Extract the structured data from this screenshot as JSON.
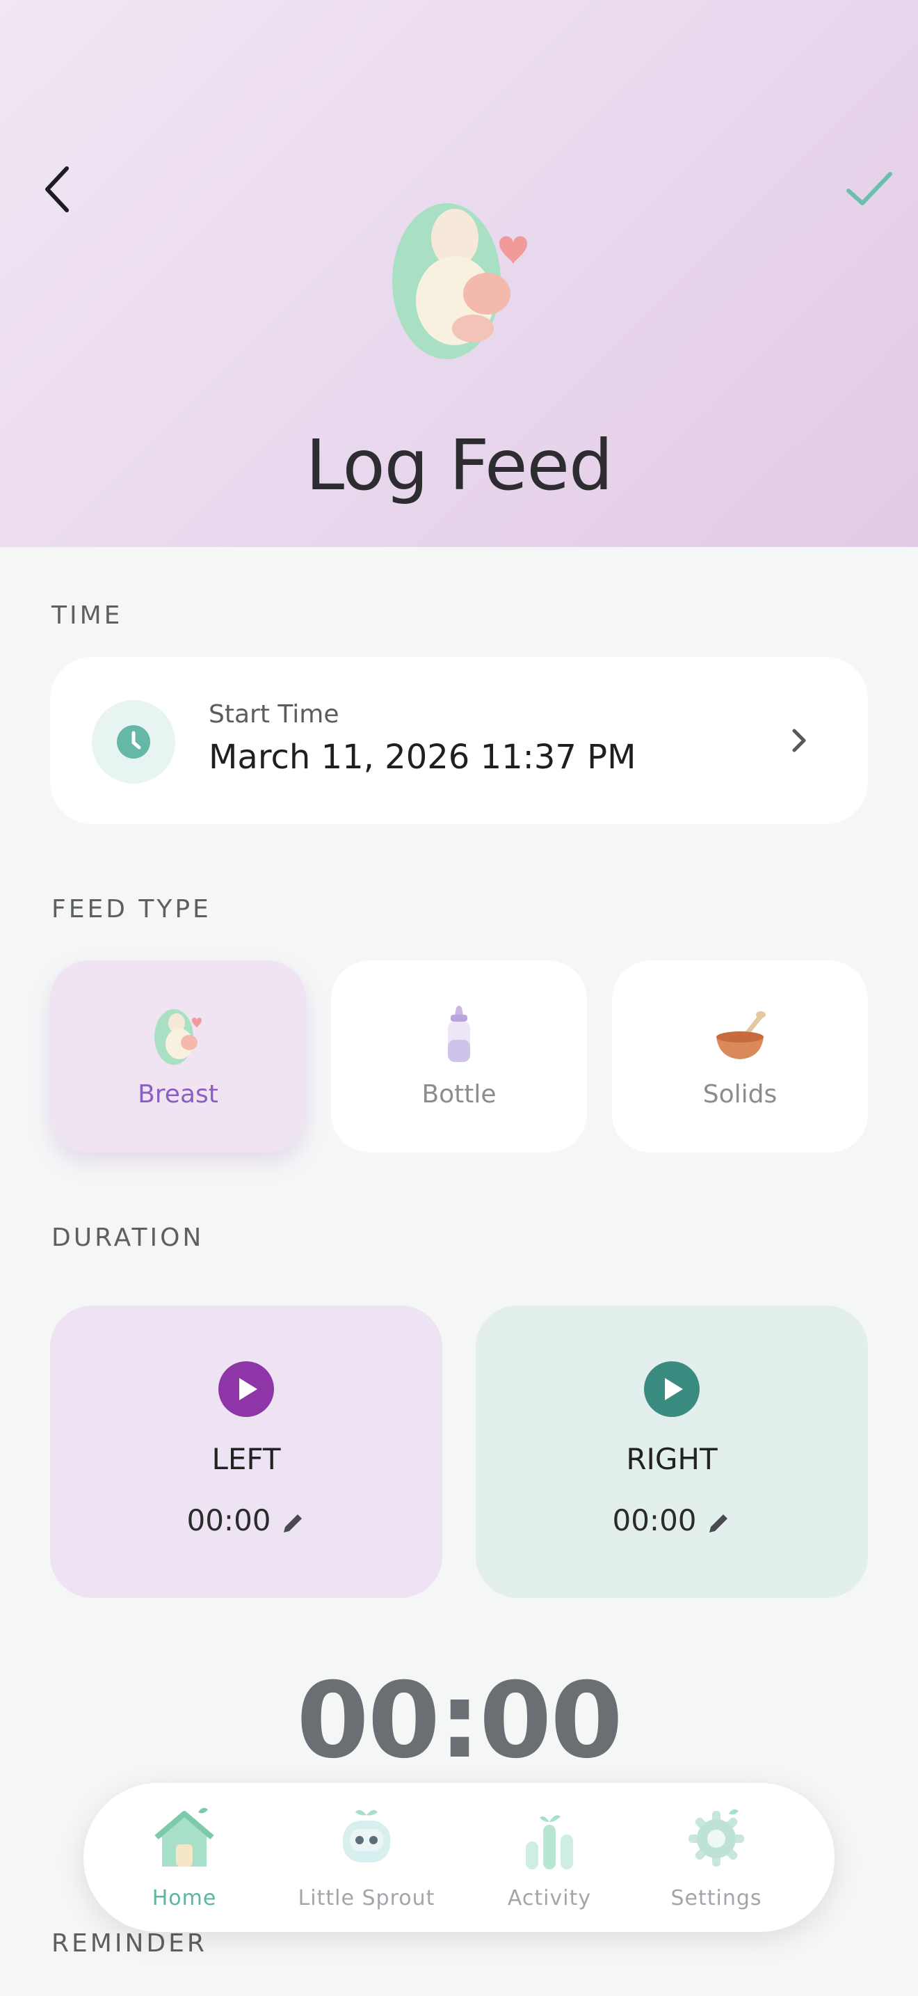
{
  "header": {
    "title": "Log Feed",
    "back_icon": "chevron-left-icon",
    "confirm_icon": "check-icon",
    "hero_icon": "mother-baby-icon"
  },
  "time_section": {
    "label": "TIME",
    "start_label": "Start Time",
    "start_value": "March 11, 2026 11:37 PM",
    "icon": "clock-icon"
  },
  "feed_type": {
    "label": "FEED TYPE",
    "options": [
      {
        "label": "Breast",
        "icon": "breastfeeding-icon",
        "selected": true
      },
      {
        "label": "Bottle",
        "icon": "bottle-icon",
        "selected": false
      },
      {
        "label": "Solids",
        "icon": "bowl-icon",
        "selected": false
      }
    ]
  },
  "duration": {
    "label": "DURATION",
    "left": {
      "side": "LEFT",
      "time": "00:00"
    },
    "right": {
      "side": "RIGHT",
      "time": "00:00"
    },
    "total": "00:00"
  },
  "reminder": {
    "label": "REMINDER"
  },
  "tabbar": {
    "items": [
      {
        "label": "Home",
        "icon": "home-icon",
        "active": true
      },
      {
        "label": "Little Sprout",
        "icon": "robot-sprout-icon",
        "active": false
      },
      {
        "label": "Activity",
        "icon": "bar-chart-icon",
        "active": false
      },
      {
        "label": "Settings",
        "icon": "gear-icon",
        "active": false
      }
    ]
  },
  "colors": {
    "accent_purple": "#8b5fc0",
    "accent_teal": "#5fb5a4",
    "play_left": "#8e35a8",
    "play_right": "#3a8b80"
  }
}
